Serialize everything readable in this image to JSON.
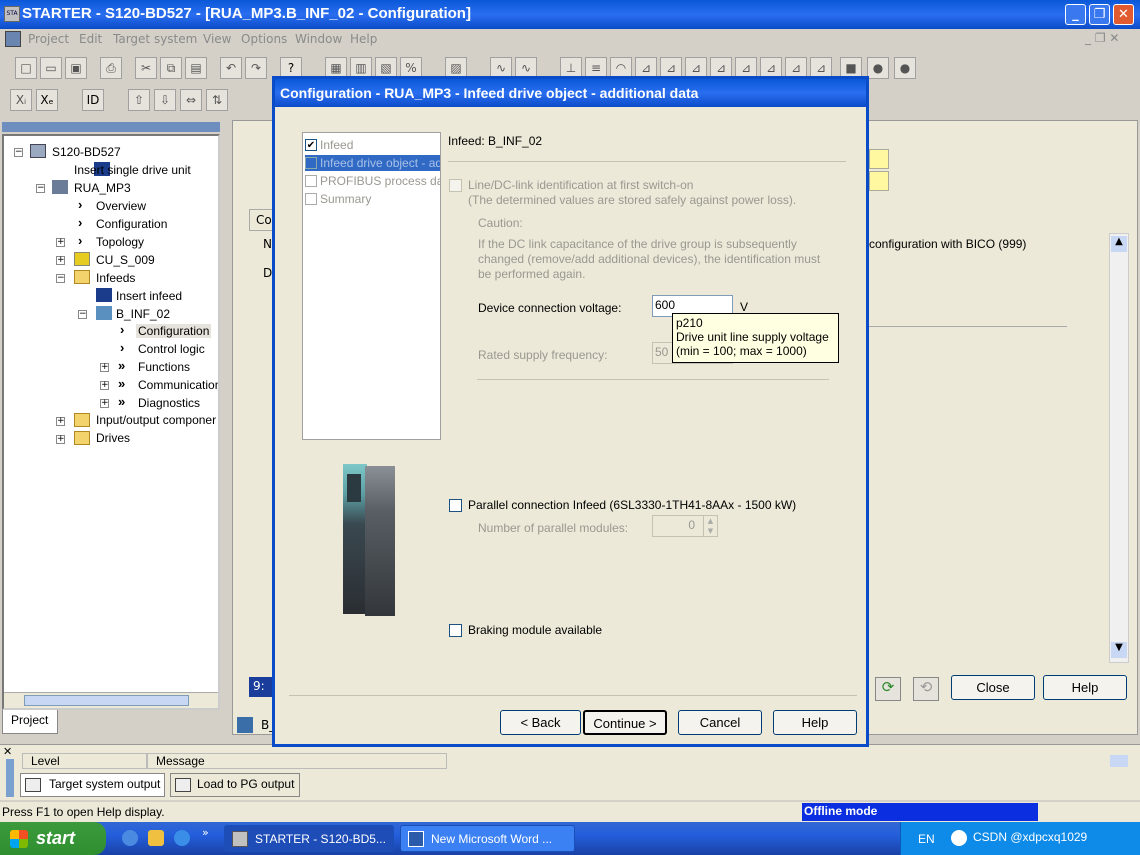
{
  "app": {
    "title": "STARTER - S120-BD527 - [RUA_MP3.B_INF_02 - Configuration]",
    "menu": [
      "Project",
      "Edit",
      "Target system",
      "View",
      "Options",
      "Window",
      "Help"
    ]
  },
  "tree": {
    "items": [
      {
        "label": "S120-BD527"
      },
      {
        "label": "Insert single drive unit"
      },
      {
        "label": "RUA_MP3"
      },
      {
        "label": "Overview"
      },
      {
        "label": "Configuration"
      },
      {
        "label": "Topology"
      },
      {
        "label": "CU_S_009"
      },
      {
        "label": "Infeeds"
      },
      {
        "label": "Insert infeed"
      },
      {
        "label": "B_INF_02"
      },
      {
        "label": "Configuration"
      },
      {
        "label": "Control logic"
      },
      {
        "label": "Functions"
      },
      {
        "label": "Communication"
      },
      {
        "label": "Diagnostics"
      },
      {
        "label": "Input/output componer"
      },
      {
        "label": "Drives"
      }
    ],
    "tab": "Project"
  },
  "bg": {
    "tab_frag": "Co",
    "n_frag": "N",
    "d_frag": "D",
    "bico_text": "configuration with BICO (999)",
    "status_frag": "9:",
    "close": "Close",
    "help": "Help",
    "bottom_frag": "B_"
  },
  "output": {
    "level": "Level",
    "message": "Message",
    "tab_target": "Target system output",
    "tab_load": "Load to PG output"
  },
  "status": {
    "hint": "Press F1 to open Help display.",
    "mode": "Offline mode"
  },
  "dialog": {
    "title": "Configuration - RUA_MP3 - Infeed drive object - additional data",
    "steps": [
      "Infeed",
      "Infeed drive object - ad",
      "PROFIBUS process da",
      "Summary"
    ],
    "infeed_label": "Infeed: B_INF_02",
    "ident_label": "Line/DC-link identification at first switch-on",
    "ident_note": "(The determined values are stored safely against power loss).",
    "caution": "Caution:",
    "caution_text1": "If the DC link capacitance of the drive group is subsequently",
    "caution_text2": "changed (remove/add additional devices), the identification must",
    "caution_text3": "be performed again.",
    "voltage_label": "Device connection voltage:",
    "voltage_value": "600",
    "voltage_unit": "V",
    "tooltip_param": "p210",
    "tooltip_desc": "Drive unit line supply voltage",
    "tooltip_range": "(min = 100; max = 1000)",
    "freq_label": "Rated supply frequency:",
    "freq_value": "50",
    "parallel_label": "Parallel connection Infeed (6SL3330-1TH41-8AAx - 1500 kW)",
    "parallel_count_label": "Number of parallel modules:",
    "parallel_count": "0",
    "braking_label": "Braking module available",
    "back": "< Back",
    "continue": "Continue >",
    "cancel": "Cancel",
    "help": "Help"
  },
  "taskbar": {
    "start": "start",
    "item1": "STARTER - S120-BD5...",
    "item2": "New Microsoft Word ...",
    "lang": "EN",
    "tray": "CSDN @xdpcxq1029"
  }
}
